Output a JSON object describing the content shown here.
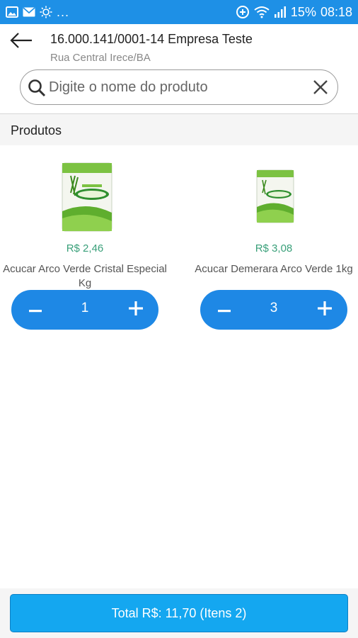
{
  "status_bar": {
    "more": "...",
    "battery": "15%",
    "time": "08:18"
  },
  "header": {
    "title": "16.000.141/0001-14 Empresa Teste",
    "subtitle": "Rua Central Irece/BA"
  },
  "search": {
    "placeholder": "Digite o nome do produto",
    "value": ""
  },
  "section": {
    "title": "Produtos"
  },
  "products": [
    {
      "price": "R$ 2,46",
      "name": "Acucar Arco Verde Cristal Especial Kg",
      "quantity": "1"
    },
    {
      "price": "R$ 3,08",
      "name": "Acucar Demerara Arco Verde 1kg",
      "quantity": "3"
    }
  ],
  "footer": {
    "total_label": "Total R$: 11,70 (Itens 2)"
  },
  "colors": {
    "primary": "#1e88e5",
    "status_bar": "#1e90e6",
    "price": "#3aa07a",
    "total_button": "#14a7f0"
  },
  "icons": [
    "gallery-icon",
    "mail-icon",
    "sun-icon",
    "data-saver-icon",
    "wifi-icon",
    "signal-icon",
    "back-arrow-icon",
    "search-icon",
    "clear-icon",
    "minus-icon",
    "plus-icon"
  ]
}
